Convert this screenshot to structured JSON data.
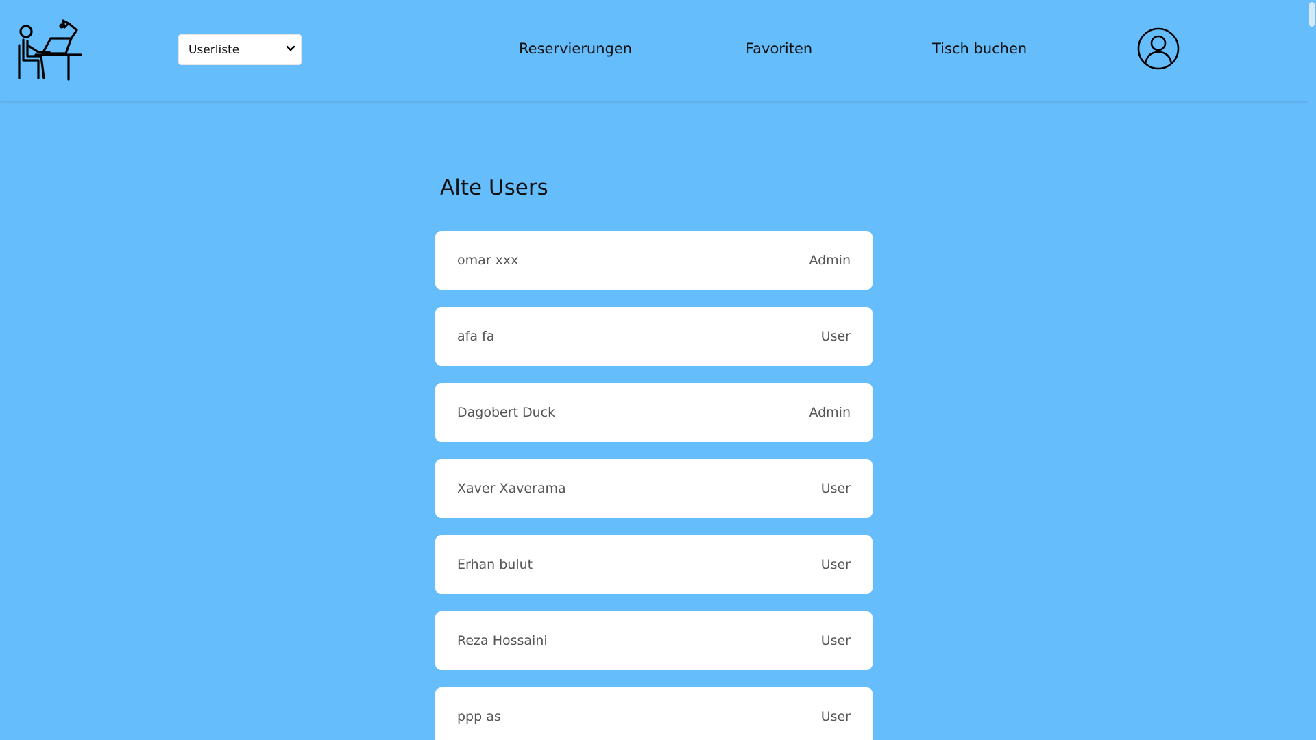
{
  "header": {
    "logo_icon": "person-at-desk-icon",
    "view_select": {
      "selected": "Userliste",
      "options": [
        "Userliste"
      ]
    },
    "nav": [
      {
        "label": "Reservierungen"
      },
      {
        "label": "Favoriten"
      },
      {
        "label": "Tisch buchen"
      }
    ],
    "avatar_icon": "user-profile-icon"
  },
  "main": {
    "title": "Alte Users",
    "users": [
      {
        "name": "omar xxx",
        "role": "Admin"
      },
      {
        "name": "afa fa",
        "role": "User"
      },
      {
        "name": "Dagobert Duck",
        "role": "Admin"
      },
      {
        "name": "Xaver Xaverama",
        "role": "User"
      },
      {
        "name": "Erhan bulut",
        "role": "User"
      },
      {
        "name": "Reza Hossaini",
        "role": "User"
      },
      {
        "name": "ppp as",
        "role": "User"
      }
    ]
  },
  "colors": {
    "background": "#66bdfc",
    "card": "#ffffff",
    "text": "#111111",
    "muted_text": "#555555"
  }
}
